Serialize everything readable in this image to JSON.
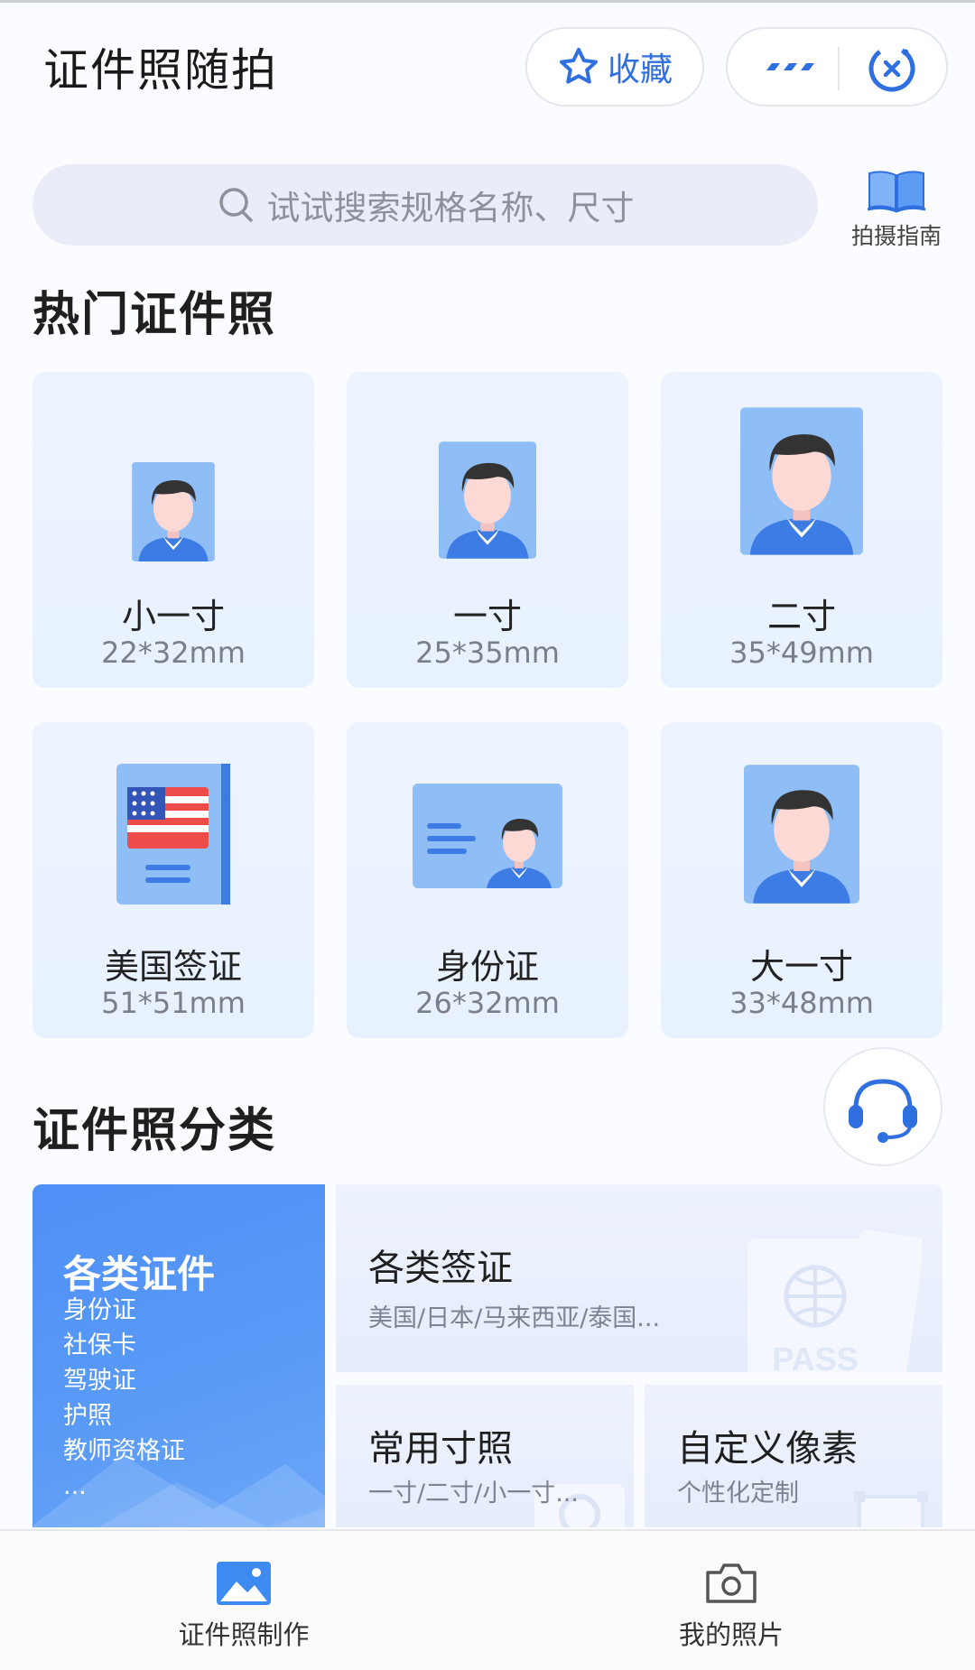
{
  "header": {
    "title": "证件照随拍",
    "favorite_label": "收藏"
  },
  "search": {
    "placeholder": "试试搜索规格名称、尺寸"
  },
  "guide_label": "拍摄指南",
  "hot": {
    "title": "热门证件照",
    "cards": [
      {
        "name": "小一寸",
        "size": "22*32mm",
        "icon": "portrait-small-icon"
      },
      {
        "name": "一寸",
        "size": "25*35mm",
        "icon": "portrait-icon"
      },
      {
        "name": "二寸",
        "size": "35*49mm",
        "icon": "portrait-large-icon"
      },
      {
        "name": "美国签证",
        "size": "51*51mm",
        "icon": "us-visa-icon"
      },
      {
        "name": "身份证",
        "size": "26*32mm",
        "icon": "id-card-icon"
      },
      {
        "name": "大一寸",
        "size": "33*48mm",
        "icon": "portrait-large-icon"
      }
    ]
  },
  "category": {
    "title": "证件照分类",
    "main": {
      "title": "各类证件",
      "items": [
        "身份证",
        "社保卡",
        "驾驶证",
        "护照",
        "教师资格证",
        "..."
      ]
    },
    "visa": {
      "title": "各类签证",
      "subtitle": "美国/日本/马来西亚/泰国...",
      "watermark": "PASS"
    },
    "common": {
      "title": "常用寸照",
      "subtitle": "一寸/二寸/小一寸..."
    },
    "custom": {
      "title": "自定义像素",
      "subtitle": "个性化定制"
    }
  },
  "nav": {
    "make_label": "证件照制作",
    "photos_label": "我的照片"
  },
  "colors": {
    "accent": "#2f6fe0",
    "card_bg": "#eaf2ff",
    "main_category": "#4d8ff5",
    "shirt": "#3d7ce4",
    "hair": "#333333"
  }
}
